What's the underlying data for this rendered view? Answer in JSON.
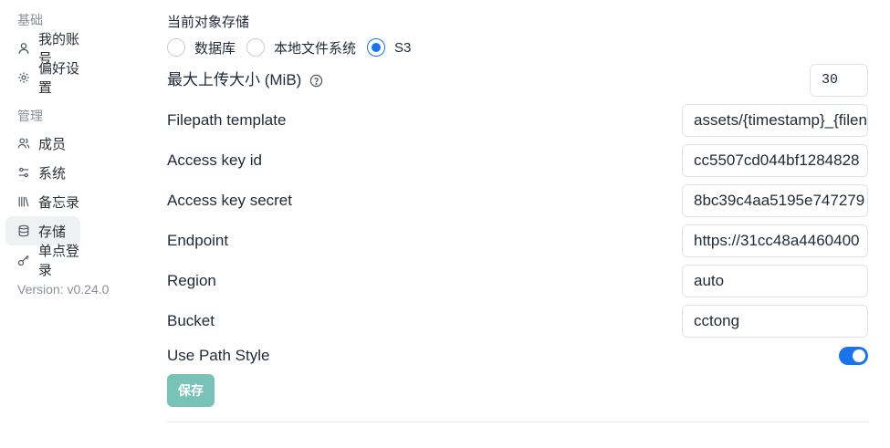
{
  "sidebar": {
    "basics_label": "基础",
    "admin_label": "管理",
    "items": [
      {
        "label": "我的账号",
        "icon": "user-icon"
      },
      {
        "label": "偏好设置",
        "icon": "gear-icon"
      },
      {
        "label": "成员",
        "icon": "users-icon"
      },
      {
        "label": "系统",
        "icon": "sliders-icon"
      },
      {
        "label": "备忘录",
        "icon": "library-icon"
      },
      {
        "label": "存储",
        "icon": "database-icon",
        "active": true
      },
      {
        "label": "单点登录",
        "icon": "key-icon"
      }
    ],
    "version": "Version: v0.24.0"
  },
  "main": {
    "title": "当前对象存储",
    "storage_options": [
      {
        "label": "数据库",
        "checked": false
      },
      {
        "label": "本地文件系统",
        "checked": false
      },
      {
        "label": "S3",
        "checked": true
      }
    ],
    "max_upload": {
      "label": "最大上传大小 (MiB)",
      "value": "30"
    },
    "fields": {
      "filepath_template": {
        "label": "Filepath template",
        "value": "assets/{timestamp}_{filename}"
      },
      "access_key_id": {
        "label": "Access key id",
        "value": "cc5507cd044bf1284828"
      },
      "access_key_secret": {
        "label": "Access key secret",
        "value": "8bc39c4aa5195e747279"
      },
      "endpoint": {
        "label": "Endpoint",
        "value": "https://31cc48a4460400"
      },
      "region": {
        "label": "Region",
        "value": "auto"
      },
      "bucket": {
        "label": "Bucket",
        "value": "cctong"
      }
    },
    "path_style": {
      "label": "Use Path Style",
      "enabled": true
    },
    "save_label": "保存"
  },
  "colors": {
    "accent": "#1a73e8",
    "save_button": "#79c2b8",
    "active_nav_bg": "#f0f1f3"
  }
}
